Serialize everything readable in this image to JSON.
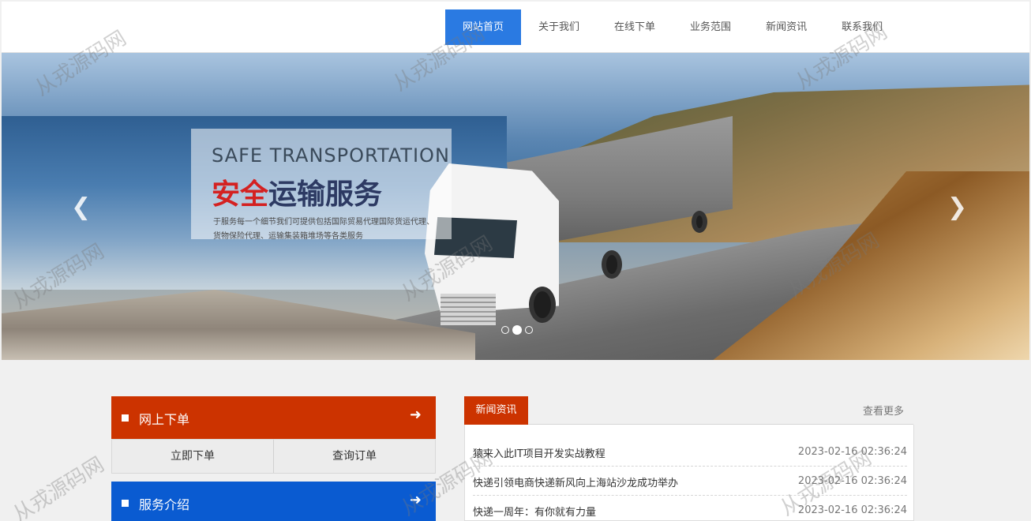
{
  "nav": {
    "items": [
      "网站首页",
      "关于我们",
      "在线下单",
      "业务范围",
      "新闻资讯",
      "联系我们"
    ],
    "active_index": 0
  },
  "banner": {
    "title_en": "SAFE TRANSPORTATION",
    "title_cn_red": "安全",
    "title_cn_dark": "运输服务",
    "description": "于服务每一个细节我们可提供包括国际贸易代理国际货运代理、货物保险代理、运输集装箱堆场等各类服务",
    "prev_icon": "chevron-left-icon",
    "next_icon": "chevron-right-icon",
    "slide_count": 3,
    "active_slide": 1
  },
  "order_panel": {
    "title": "网上下单",
    "arrow": "➜",
    "buttons": [
      "立即下单",
      "查询订单"
    ]
  },
  "service_panel": {
    "title": "服务介绍",
    "arrow": "➜"
  },
  "news": {
    "tab_label": "新闻资讯",
    "more_label": "查看更多",
    "items": [
      {
        "title": "猿来入此IT项目开发实战教程",
        "date": "2023-02-16 02:36:24"
      },
      {
        "title": "快递引领电商快递新风向上海站沙龙成功举办",
        "date": "2023-02-16 02:36:24"
      },
      {
        "title": "快递一周年：有你就有力量",
        "date": "2023-02-16 02:36:24"
      }
    ]
  },
  "watermark": "从戎源码网",
  "colors": {
    "nav_active": "#2a7ae2",
    "order_head": "#cc3300",
    "service_head": "#0a5bd1",
    "news_tab": "#cc3300",
    "caption_red": "#d42121"
  }
}
